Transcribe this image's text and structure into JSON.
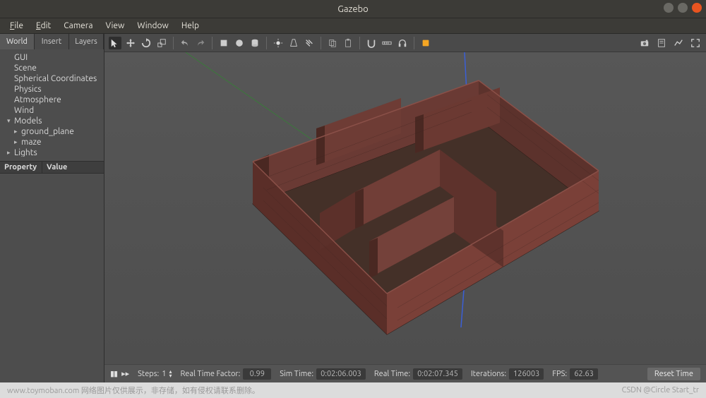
{
  "window": {
    "title": "Gazebo"
  },
  "menus": {
    "file": "File",
    "edit": "Edit",
    "camera": "Camera",
    "view": "View",
    "window": "Window",
    "help": "Help"
  },
  "left_tabs": {
    "world": "World",
    "insert": "Insert",
    "layers": "Layers"
  },
  "tree": {
    "gui": "GUI",
    "scene": "Scene",
    "spherical": "Spherical Coordinates",
    "physics": "Physics",
    "atmosphere": "Atmosphere",
    "wind": "Wind",
    "models": "Models",
    "ground_plane": "ground_plane",
    "maze": "maze",
    "lights": "Lights"
  },
  "property_panel": {
    "property": "Property",
    "value": "Value"
  },
  "status": {
    "steps_label": "Steps:",
    "steps_value": "1",
    "rtf_label": "Real Time Factor:",
    "rtf_value": "0.99",
    "sim_time_label": "Sim Time:",
    "sim_time_value": "0:02:06.003",
    "real_time_label": "Real Time:",
    "real_time_value": "0:02:07.345",
    "iterations_label": "Iterations:",
    "iterations_value": "126003",
    "fps_label": "FPS:",
    "fps_value": "62.63",
    "reset": "Reset Time"
  },
  "footer": {
    "left": "www.toymoban.com 网络图片仅供展示，非存储，如有侵权请联系删除。",
    "right": "CSDN @Circle Start_tr"
  }
}
